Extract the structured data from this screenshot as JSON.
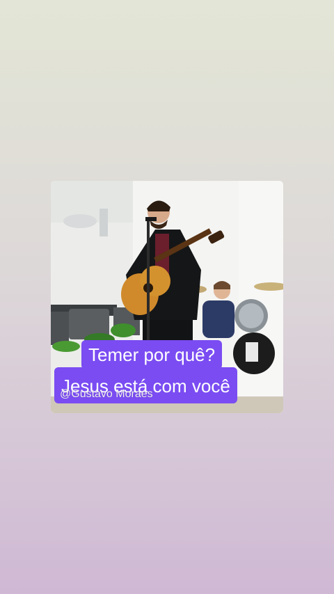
{
  "post": {
    "caption_line1": "Temer por quê?",
    "caption_line2": "Jesus está com você",
    "watermark": "@Gustavo Moraes"
  },
  "colors": {
    "caption_bg": "#7a4cf2",
    "caption_text": "#ffffff"
  }
}
